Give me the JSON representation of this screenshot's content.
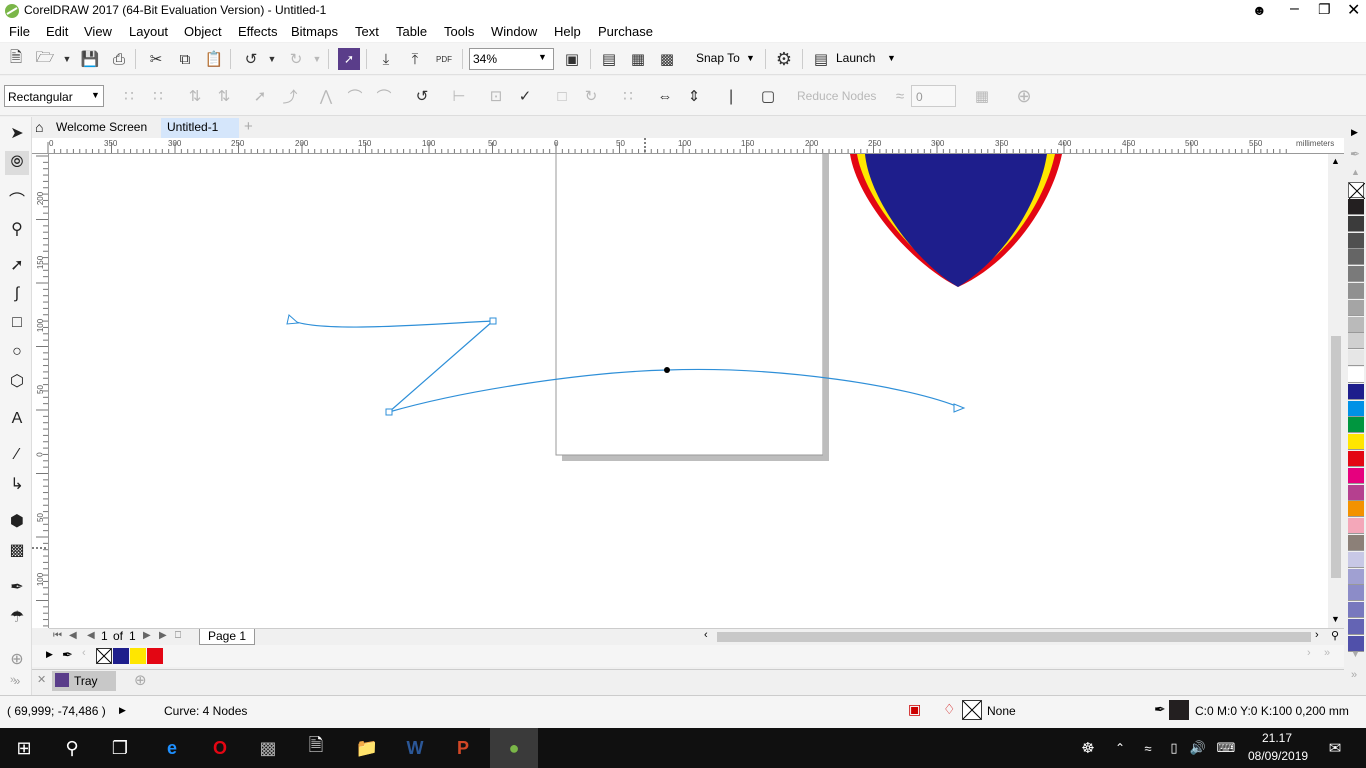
{
  "window": {
    "title": "CorelDRAW 2017 (64-Bit Evaluation Version) - Untitled-1",
    "app_icon": "coreldraw-balloon-icon"
  },
  "menu": [
    "File",
    "Edit",
    "View",
    "Layout",
    "Object",
    "Effects",
    "Bitmaps",
    "Text",
    "Table",
    "Tools",
    "Window",
    "Help",
    "Purchase"
  ],
  "standard_toolbar": {
    "zoom_value": "34%",
    "snap_to_label": "Snap To",
    "launch_label": "Launch"
  },
  "property_bar": {
    "selection_mode": "Rectangular",
    "reduce_nodes_label": "Reduce Nodes",
    "smoothing_value": "0"
  },
  "tabs": {
    "welcome": "Welcome Screen",
    "document": "Untitled-1",
    "add": "+"
  },
  "ruler": {
    "unit": "millimeters",
    "h_labels": [
      "0",
      "350",
      "300",
      "250",
      "200",
      "150",
      "100",
      "50",
      "0",
      "50",
      "100",
      "150",
      "200",
      "250",
      "300",
      "350",
      "400",
      "450",
      "500",
      "550"
    ],
    "v_labels": [
      "200",
      "150",
      "100",
      "50",
      "0",
      "50",
      "100"
    ]
  },
  "page_nav": {
    "current": "1",
    "of_label": "of",
    "total": "1",
    "page_tab": "Page 1"
  },
  "document_palette": {
    "colors": [
      "#1e1e8c",
      "#ffe600",
      "#e30613"
    ]
  },
  "tray": {
    "label": "Tray"
  },
  "status": {
    "coordinates": "( 69,999; -74,486 )",
    "object_info": "Curve: 4 Nodes",
    "fill_label": "None",
    "outline_info": "C:0 M:0 Y:0 K:100  0,200 mm"
  },
  "taskbar": {
    "time": "21.17",
    "date": "08/09/2019"
  },
  "color_palette": [
    "#231f20",
    "#3b3b3b",
    "#505050",
    "#656565",
    "#7a7a7a",
    "#909090",
    "#a5a5a5",
    "#bababa",
    "#d0d0d0",
    "#e6e6e6",
    "#ffffff",
    "#1e1e8c",
    "#0091e6",
    "#00963f",
    "#ffe600",
    "#e30613",
    "#e6007e",
    "#b5408f",
    "#f39200",
    "#f4a7b9",
    "#8c8078",
    "#c8c8e6",
    "#a0a0d2",
    "#8c8cc8",
    "#7878be",
    "#6464b4",
    "#5050aa"
  ]
}
